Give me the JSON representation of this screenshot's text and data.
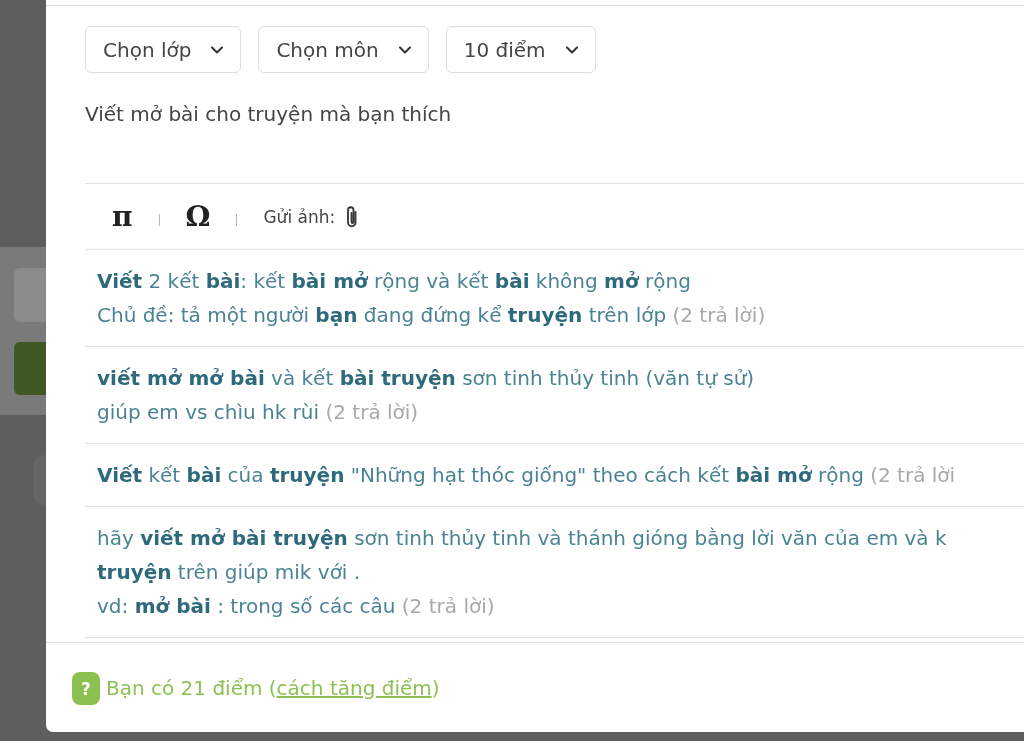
{
  "filters": [
    {
      "label": "Chọn lớp"
    },
    {
      "label": "Chọn môn"
    },
    {
      "label": "10 điểm"
    }
  ],
  "question": {
    "value": "Viết mở bài cho truyện mà bạn thích"
  },
  "toolbar": {
    "math_symbol": "π",
    "special_char": "Ω",
    "attach_label": "Gửi ảnh:"
  },
  "suggestions": [
    {
      "lines": [
        "**Viết** 2 kết **bài**: kết **bài mở** rộng và kết **bài** không **mở** rộng",
        "Chủ đề: tả một người **bạn** đang đứng kể **truyện** trên lớp"
      ],
      "replies": "(2 trả lời)"
    },
    {
      "lines": [
        "**viết mở mở bài** và kết **bài truyện** sơn tinh thủy tinh (văn tự sử)",
        "giúp em vs chìu hk rùi"
      ],
      "replies": "(2 trả lời)"
    },
    {
      "lines": [
        "**Viết** kết **bài** của **truyện** \"Những hạt thóc giống\" theo cách kết **bài mở** rộng"
      ],
      "replies": "(2 trả lời"
    },
    {
      "lines": [
        "hãy **viết mở bài truyện** sơn tinh thủy tinh và thánh gióng bằng lời văn của em và k",
        "**truyện** trên giúp mik với .",
        "vd: **mở bài** : trong số các câu"
      ],
      "replies": "(2 trả lời)"
    }
  ],
  "footer": {
    "badge": "?",
    "text": "Bạn có 21 điểm (",
    "link": "cách tăng điểm",
    "text_end": ")"
  }
}
